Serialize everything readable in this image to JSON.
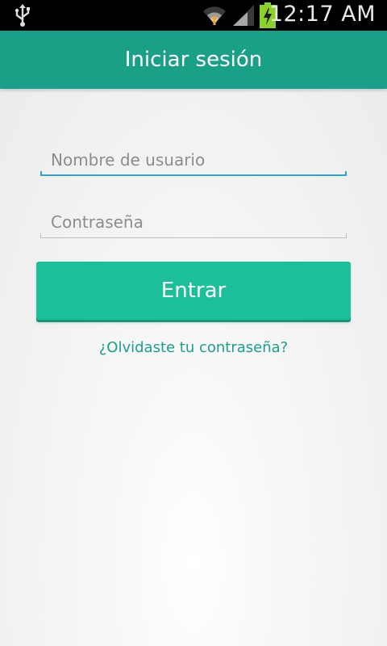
{
  "status_bar": {
    "time": "12:17 AM",
    "icons": [
      "usb-icon",
      "wifi-icon",
      "signal-icon",
      "battery-charging-icon"
    ]
  },
  "app_bar": {
    "title": "Iniciar sesión"
  },
  "form": {
    "username": {
      "placeholder": "Nombre de usuario",
      "value": ""
    },
    "password": {
      "placeholder": "Contraseña",
      "value": ""
    },
    "submit_label": "Entrar",
    "forgot_password": "¿Olvidaste tu contraseña?"
  },
  "colors": {
    "app_bar": "#1ba088",
    "button": "#1bbf9a",
    "link": "#1aa08a",
    "focus_underline": "#2aa8c4",
    "battery": "#8ad12c"
  }
}
